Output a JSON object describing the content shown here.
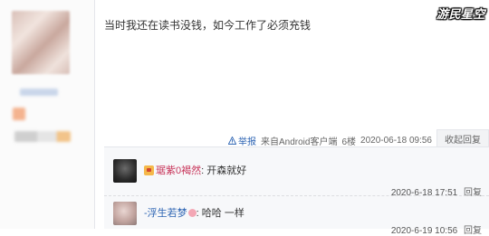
{
  "post": {
    "text": "当时我还在读书没钱，如今工作了必须充钱",
    "watermark": "游民星空"
  },
  "meta": {
    "report_label": "举报",
    "client": "来自Android客户端",
    "floor": "6楼",
    "datetime": "2020-06-18 09:56",
    "collapse_label": "收起回复"
  },
  "replies": [
    {
      "user": "琚紫0褐然",
      "separator": ":",
      "text": "开森就好",
      "datetime": "2020-6-18 17:51",
      "reply_label": "回复"
    },
    {
      "user": "-浮生若梦",
      "separator": ":",
      "text": "哈哈 一样",
      "datetime": "2020-6-19 10:56",
      "reply_label": "回复"
    }
  ],
  "icons": {
    "report": "warning-icon"
  }
}
